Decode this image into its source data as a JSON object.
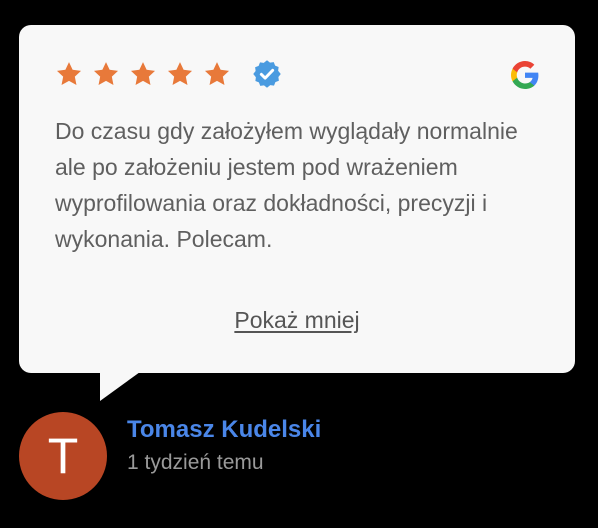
{
  "review": {
    "rating": 5,
    "rating_max": 5,
    "verified": true,
    "source_icon": "google-icon",
    "text": "Do czasu gdy założyłem wyglądały normalnie ale po założeniu jestem pod wrażeniem wyprofilowania oraz dokładności, precyzji i wykonania. Polecam.",
    "toggle_label": "Pokaż mniej"
  },
  "author": {
    "initial": "T",
    "name": "Tomasz Kudelski",
    "time_ago": "1 tydzień temu"
  },
  "colors": {
    "star": "#E8793A",
    "verified_badge": "#4A9BE0",
    "author_name": "#4A86E8",
    "avatar_bg": "#B84624",
    "card_bg": "#f8f8f8",
    "page_bg": "#000000"
  }
}
